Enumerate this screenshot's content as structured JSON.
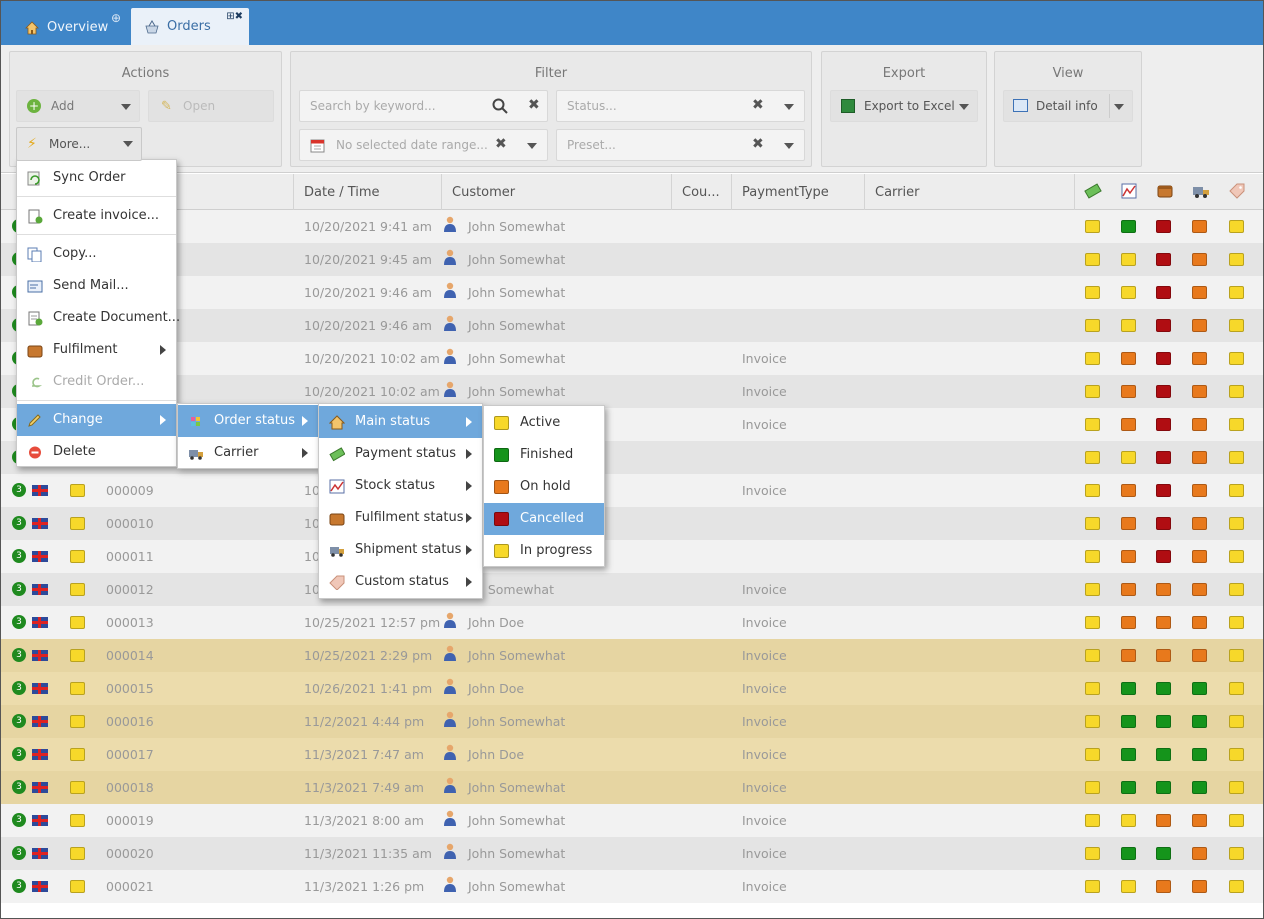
{
  "tabs": [
    {
      "label": "Overview"
    },
    {
      "label": "Orders"
    }
  ],
  "toolbar": {
    "actions_title": "Actions",
    "add_label": "Add",
    "open_label": "Open",
    "more_label": "More...",
    "filter_title": "Filter",
    "search_placeholder": "Search by keyword...",
    "status_placeholder": "Status...",
    "date_placeholder": "No selected date range...",
    "preset_placeholder": "Preset...",
    "export_title": "Export",
    "export_label": "Export to Excel",
    "view_title": "View",
    "view_label": "Detail info"
  },
  "columns": {
    "date": "Date / Time",
    "customer": "Customer",
    "country": "Cou...",
    "payment": "PaymentType",
    "carrier": "Carrier"
  },
  "more_menu": {
    "items": [
      {
        "label": "Sync Order"
      },
      {
        "label": "Create invoice..."
      },
      {
        "label": "Copy..."
      },
      {
        "label": "Send Mail..."
      },
      {
        "label": "Create Document..."
      },
      {
        "label": "Fulfilment"
      },
      {
        "label": "Credit Order..."
      },
      {
        "label": "Change"
      },
      {
        "label": "Delete"
      }
    ]
  },
  "change_menu": {
    "items": [
      {
        "label": "Order status"
      },
      {
        "label": "Carrier"
      }
    ]
  },
  "order_status_menu": {
    "items": [
      {
        "label": "Main status"
      },
      {
        "label": "Payment status"
      },
      {
        "label": "Stock status"
      },
      {
        "label": "Fulfilment status"
      },
      {
        "label": "Shipment status"
      },
      {
        "label": "Custom status"
      }
    ]
  },
  "main_status_menu": {
    "items": [
      {
        "label": "Active",
        "color": "#f7d82a"
      },
      {
        "label": "Finished",
        "color": "#15941b"
      },
      {
        "label": "On hold",
        "color": "#e8791c"
      },
      {
        "label": "Cancelled",
        "color": "#b00d12"
      },
      {
        "label": "In progress",
        "color": "#f7d82a"
      }
    ]
  },
  "rows": [
    {
      "num": "",
      "date": "10/20/2021 9:41 am",
      "customer": "John Somewhat",
      "payment": "",
      "status": [
        "yellow",
        "green",
        "red",
        "orange",
        "yellow"
      ]
    },
    {
      "num": "",
      "date": "10/20/2021 9:45 am",
      "customer": "John Somewhat",
      "payment": "",
      "status": [
        "yellow",
        "yellow",
        "red",
        "orange",
        "yellow"
      ]
    },
    {
      "num": "",
      "date": "10/20/2021 9:46 am",
      "customer": "John Somewhat",
      "payment": "",
      "status": [
        "yellow",
        "yellow",
        "red",
        "orange",
        "yellow"
      ]
    },
    {
      "num": "",
      "date": "10/20/2021 9:46 am",
      "customer": "John Somewhat",
      "payment": "",
      "status": [
        "yellow",
        "yellow",
        "red",
        "orange",
        "yellow"
      ]
    },
    {
      "num": "",
      "date": "10/20/2021 10:02 am",
      "customer": "John Somewhat",
      "payment": "Invoice",
      "status": [
        "yellow",
        "orange",
        "red",
        "orange",
        "yellow"
      ]
    },
    {
      "num": "",
      "date": "10/20/2021 10:02 am",
      "customer": "John Somewhat",
      "payment": "Invoice",
      "status": [
        "yellow",
        "orange",
        "red",
        "orange",
        "yellow"
      ]
    },
    {
      "num": "",
      "date": "",
      "customer": "",
      "payment": "Invoice",
      "status": [
        "yellow",
        "orange",
        "red",
        "orange",
        "yellow"
      ]
    },
    {
      "num": "",
      "date": "",
      "customer": "",
      "payment": "",
      "status": [
        "yellow",
        "yellow",
        "red",
        "orange",
        "yellow"
      ]
    },
    {
      "num": "000009",
      "date": "10",
      "customer": "",
      "payment": "Invoice",
      "status": [
        "yellow",
        "orange",
        "red",
        "orange",
        "yellow"
      ]
    },
    {
      "num": "000010",
      "date": "10",
      "customer": "",
      "payment": "",
      "status": [
        "yellow",
        "orange",
        "red",
        "orange",
        "yellow"
      ]
    },
    {
      "num": "000011",
      "date": "10",
      "customer": "",
      "payment": "",
      "status": [
        "yellow",
        "orange",
        "red",
        "orange",
        "yellow"
      ]
    },
    {
      "num": "000012",
      "date": "10",
      "customer": "hn Somewhat",
      "payment": "Invoice",
      "status": [
        "yellow",
        "orange",
        "orange",
        "orange",
        "yellow"
      ]
    },
    {
      "num": "000013",
      "date": "10/25/2021 12:57 pm",
      "customer": "John Doe",
      "payment": "Invoice",
      "status": [
        "yellow",
        "orange",
        "orange",
        "orange",
        "yellow"
      ]
    },
    {
      "num": "000014",
      "date": "10/25/2021 2:29 pm",
      "customer": "John Somewhat",
      "payment": "Invoice",
      "status": [
        "yellow",
        "orange",
        "orange",
        "orange",
        "yellow"
      ]
    },
    {
      "num": "000015",
      "date": "10/26/2021 1:41 pm",
      "customer": "John Doe",
      "payment": "Invoice",
      "status": [
        "yellow",
        "green",
        "green",
        "green",
        "yellow"
      ]
    },
    {
      "num": "000016",
      "date": "11/2/2021 4:44 pm",
      "customer": "John Somewhat",
      "payment": "Invoice",
      "status": [
        "yellow",
        "green",
        "green",
        "green",
        "yellow"
      ]
    },
    {
      "num": "000017",
      "date": "11/3/2021 7:47 am",
      "customer": "John Doe",
      "payment": "Invoice",
      "status": [
        "yellow",
        "green",
        "green",
        "green",
        "yellow"
      ]
    },
    {
      "num": "000018",
      "date": "11/3/2021 7:49 am",
      "customer": "John Somewhat",
      "payment": "Invoice",
      "status": [
        "yellow",
        "green",
        "green",
        "green",
        "yellow"
      ]
    },
    {
      "num": "000019",
      "date": "11/3/2021 8:00 am",
      "customer": "John Somewhat",
      "payment": "Invoice",
      "status": [
        "yellow",
        "yellow",
        "orange",
        "orange",
        "yellow"
      ]
    },
    {
      "num": "000020",
      "date": "11/3/2021 11:35 am",
      "customer": "John Somewhat",
      "payment": "Invoice",
      "status": [
        "yellow",
        "green",
        "green",
        "orange",
        "yellow"
      ]
    },
    {
      "num": "000021",
      "date": "11/3/2021 1:26 pm",
      "customer": "John Somewhat",
      "payment": "Invoice",
      "status": [
        "yellow",
        "yellow",
        "orange",
        "orange",
        "yellow"
      ]
    }
  ]
}
